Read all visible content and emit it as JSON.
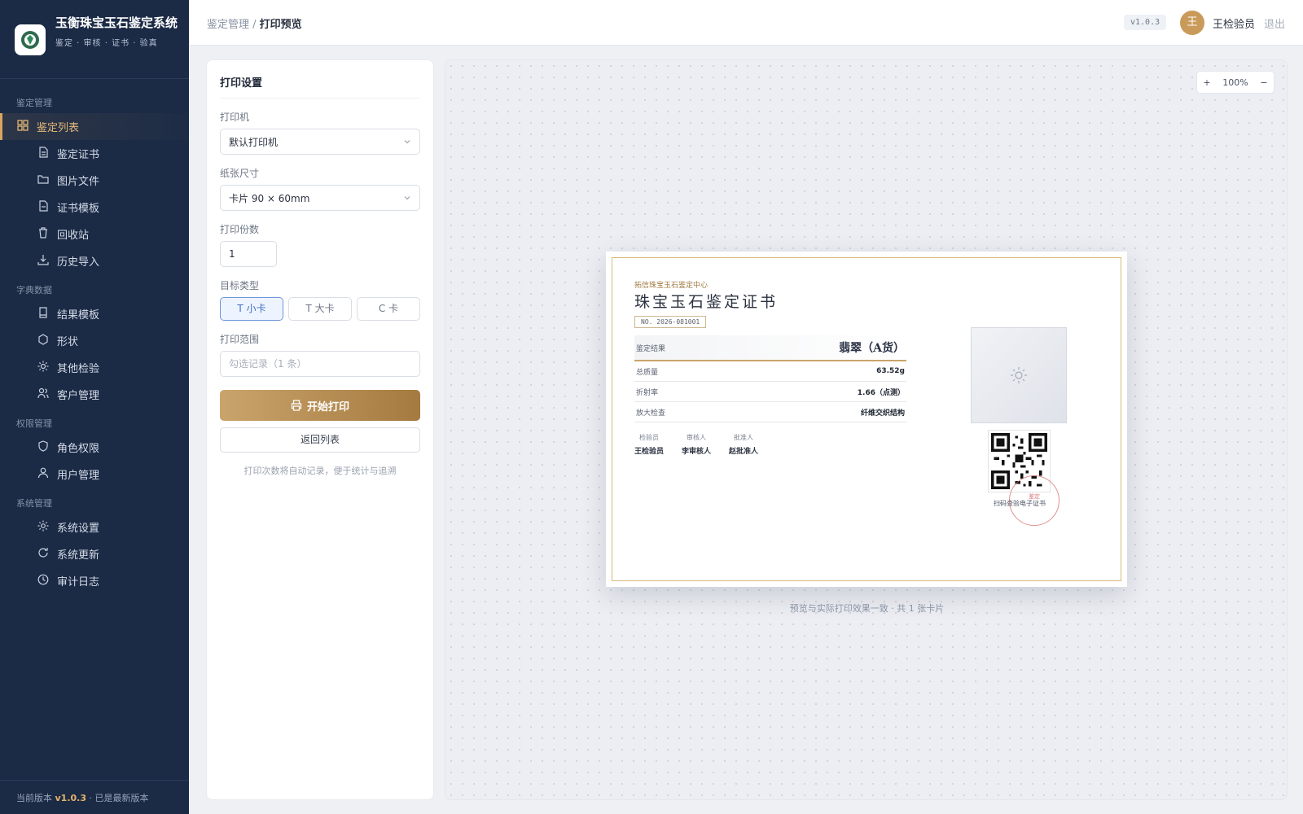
{
  "brand": {
    "title": "玉衡珠宝玉石鉴定系统",
    "subtitle": "鉴定 · 审核 · 证书 · 验真"
  },
  "sidebar": {
    "groups": [
      {
        "label": "鉴定管理",
        "items": [
          {
            "label": "鉴定列表",
            "icon": "grid-icon",
            "active": true
          },
          {
            "label": "鉴定证书",
            "icon": "document-icon"
          },
          {
            "label": "图片文件",
            "icon": "folder-icon"
          },
          {
            "label": "证书模板",
            "icon": "file-icon"
          },
          {
            "label": "回收站",
            "icon": "trash-icon"
          },
          {
            "label": "历史导入",
            "icon": "download-icon"
          }
        ]
      },
      {
        "label": "字典数据",
        "items": [
          {
            "label": "结果模板",
            "icon": "book-icon"
          },
          {
            "label": "形状",
            "icon": "hexagon-icon"
          },
          {
            "label": "其他检验",
            "icon": "sun-icon"
          },
          {
            "label": "客户管理",
            "icon": "users-icon"
          }
        ]
      },
      {
        "label": "权限管理",
        "items": [
          {
            "label": "角色权限",
            "icon": "shield-icon"
          },
          {
            "label": "用户管理",
            "icon": "user-icon"
          }
        ]
      },
      {
        "label": "系统管理",
        "items": [
          {
            "label": "系统设置",
            "icon": "gear-icon"
          },
          {
            "label": "系统更新",
            "icon": "refresh-icon"
          },
          {
            "label": "审计日志",
            "icon": "clock-icon"
          }
        ]
      }
    ],
    "footer_prefix": "当前版本",
    "footer_version": "v1.0.3",
    "footer_suffix": " · 已是最新版本"
  },
  "header": {
    "breadcrumb_parent": "鉴定管理",
    "breadcrumb_sep": " / ",
    "breadcrumb_current": "打印预览",
    "version_badge": "v1.0.3",
    "avatar_initial": "王",
    "user_name": "王检验员",
    "logout": "退出"
  },
  "print_settings": {
    "title": "打印设置",
    "printer_label": "打印机",
    "printer_value": "默认打印机",
    "paper_label": "纸张尺寸",
    "paper_value": "卡片 90 × 60mm",
    "copies_label": "打印份数",
    "copies_value": "1",
    "target_label": "目标类型",
    "target_types": [
      "T 小卡",
      "T 大卡",
      "C 卡"
    ],
    "target_selected": "T 小卡",
    "range_label": "打印范围",
    "range_placeholder": "勾选记录（1 条）",
    "print_button": "开始打印",
    "back_button": "返回列表",
    "hint": "打印次数将自动记录，便于统计与追溯"
  },
  "preview": {
    "zoom_in": "+",
    "zoom_level": "100%",
    "zoom_out": "−",
    "footer_note": "预览与实际打印效果一致 · 共 1 张卡片"
  },
  "certificate": {
    "org": "拓信珠宝玉石鉴定中心",
    "title": "珠宝玉石鉴定证书",
    "number": "NO. 2026-081001",
    "result_label": "鉴定结果",
    "result_value": "翡翠（A货）",
    "rows": [
      {
        "label": "总质量",
        "value": "63.52g"
      },
      {
        "label": "折射率",
        "value": "1.66（点测）"
      },
      {
        "label": "放大检查",
        "value": "纤维交织结构"
      }
    ],
    "signers": [
      {
        "role": "检验员",
        "name": "王检验员"
      },
      {
        "role": "审核人",
        "name": "李审核人"
      },
      {
        "role": "批准人",
        "name": "赵批准人"
      }
    ],
    "qr_caption": "扫码查验电子证书",
    "stamp_text": "鉴定"
  },
  "colors": {
    "sidebar_bg": "#1b2a45",
    "accent_gold": "#c9a46b",
    "active_text": "#e3b878",
    "selected_blue": "#3f6fc3"
  }
}
